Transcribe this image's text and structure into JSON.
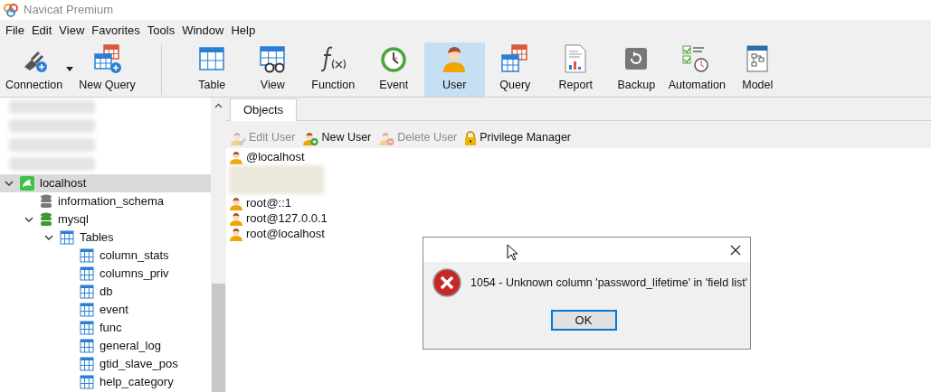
{
  "window": {
    "title": "Navicat Premium"
  },
  "menu": [
    "File",
    "Edit",
    "View",
    "Favorites",
    "Tools",
    "Window",
    "Help"
  ],
  "toolbar_left": [
    {
      "label": "Connection",
      "kind": "connection",
      "dropdown": true
    },
    {
      "label": "New Query",
      "kind": "newquery",
      "dropdown": false
    }
  ],
  "toolbar": [
    {
      "label": "Table",
      "kind": "table",
      "selected": false
    },
    {
      "label": "View",
      "kind": "view",
      "selected": false
    },
    {
      "label": "Function",
      "kind": "function",
      "selected": false
    },
    {
      "label": "Event",
      "kind": "event",
      "selected": false
    },
    {
      "label": "User",
      "kind": "user",
      "selected": true
    },
    {
      "label": "Query",
      "kind": "query",
      "selected": false
    },
    {
      "label": "Report",
      "kind": "report",
      "selected": false
    },
    {
      "label": "Backup",
      "kind": "backup",
      "selected": false
    },
    {
      "label": "Automation",
      "kind": "automation",
      "selected": false
    },
    {
      "label": "Model",
      "kind": "model",
      "selected": false
    }
  ],
  "sidebar": {
    "items": [
      {
        "label": "localhost",
        "kind": "connection",
        "selected": true,
        "expanded": true,
        "children": [
          {
            "label": "information_schema",
            "kind": "db-closed",
            "selected": false
          },
          {
            "label": "mysql",
            "kind": "db-open",
            "selected": false,
            "expanded": true,
            "children": [
              {
                "label": "Tables",
                "kind": "folder",
                "selected": false,
                "expanded": true,
                "children": [
                  {
                    "label": "column_stats",
                    "kind": "table",
                    "selected": false
                  },
                  {
                    "label": "columns_priv",
                    "kind": "table",
                    "selected": false
                  },
                  {
                    "label": "db",
                    "kind": "table",
                    "selected": false
                  },
                  {
                    "label": "event",
                    "kind": "table",
                    "selected": false
                  },
                  {
                    "label": "func",
                    "kind": "table",
                    "selected": false
                  },
                  {
                    "label": "general_log",
                    "kind": "table",
                    "selected": false
                  },
                  {
                    "label": "gtid_slave_pos",
                    "kind": "table",
                    "selected": false
                  },
                  {
                    "label": "help_category",
                    "kind": "table",
                    "selected": false
                  }
                ]
              }
            ]
          }
        ]
      }
    ]
  },
  "tabs": [
    {
      "label": "Objects",
      "selected": true
    }
  ],
  "actions": [
    {
      "label": "Edit User",
      "kind": "edit",
      "disabled": true
    },
    {
      "label": "New User",
      "kind": "new",
      "disabled": false
    },
    {
      "label": "Delete User",
      "kind": "delete",
      "disabled": true
    },
    {
      "label": "Privilege Manager",
      "kind": "lock",
      "disabled": false
    }
  ],
  "users_top": [
    "@localhost"
  ],
  "users": [
    "root@::1",
    "root@127.0.0.1",
    "root@localhost"
  ],
  "dialog": {
    "message": "1054 - Unknown column 'password_lifetime' in 'field list'",
    "button": "OK"
  }
}
